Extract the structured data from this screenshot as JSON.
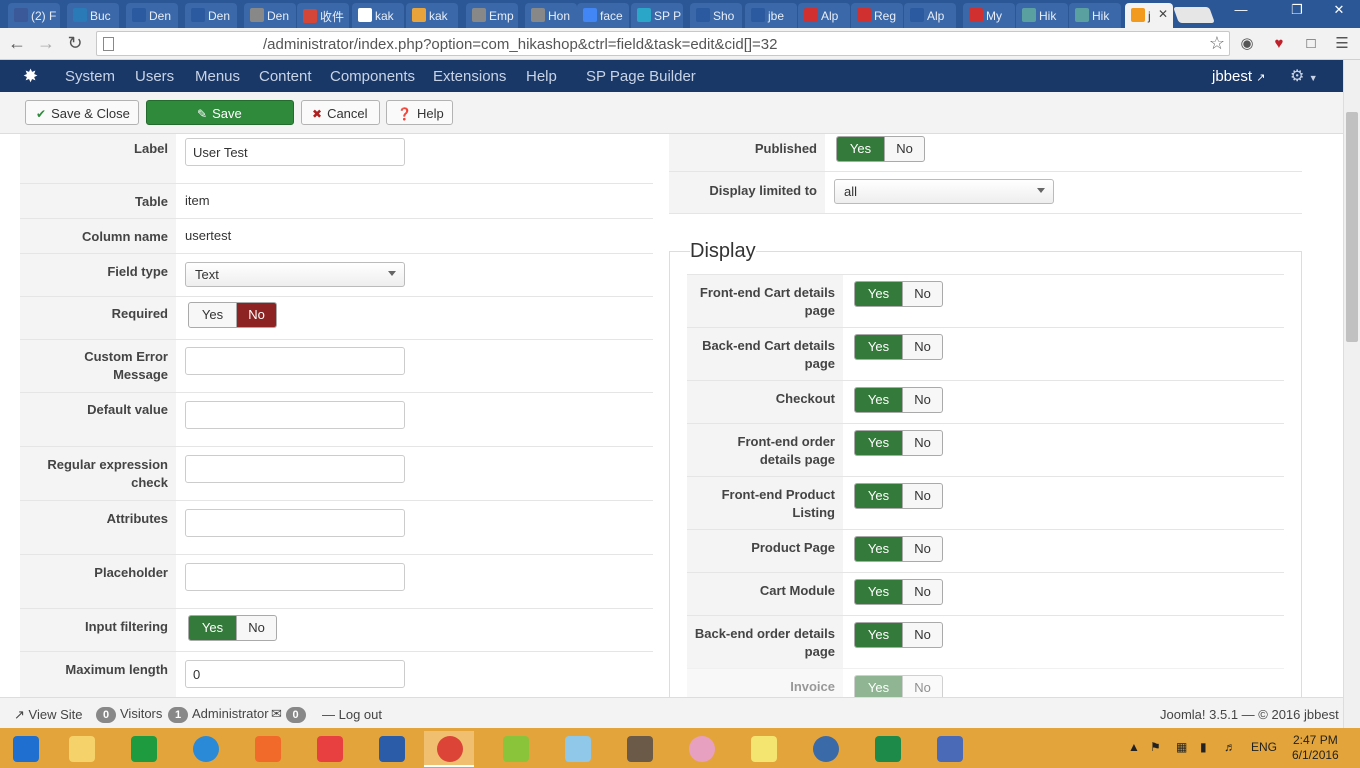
{
  "browser": {
    "tabs": [
      {
        "label": "(2) F",
        "color": "#3b5998"
      },
      {
        "label": "Buc",
        "color": "#2a7ab8"
      },
      {
        "label": "Den",
        "color": "#2c5aa0"
      },
      {
        "label": "Den",
        "color": "#2c5aa0"
      },
      {
        "label": "Den",
        "color": "#888888"
      },
      {
        "label": "收件",
        "color": "#d44638"
      },
      {
        "label": "kak",
        "color": "#ffffff"
      },
      {
        "label": "kak",
        "color": "#e8a33a"
      },
      {
        "label": "Emp",
        "color": "#888888"
      },
      {
        "label": "Hon",
        "color": "#888888"
      },
      {
        "label": "face",
        "color": "#4285f4"
      },
      {
        "label": "SP P",
        "color": "#2aa6c8"
      },
      {
        "label": "Sho",
        "color": "#2c5aa0"
      },
      {
        "label": "jbe",
        "color": "#2c5aa0"
      },
      {
        "label": "Alp",
        "color": "#d03030"
      },
      {
        "label": "Reg",
        "color": "#d03030"
      },
      {
        "label": "Alp",
        "color": "#2c5aa0"
      },
      {
        "label": "My",
        "color": "#d03030"
      },
      {
        "label": "Hik",
        "color": "#5aa0a0"
      },
      {
        "label": "Hik",
        "color": "#5aa0a0"
      },
      {
        "label": "j",
        "color": "#f29a1e"
      }
    ],
    "url": "/administrator/index.php?option=com_hikashop&ctrl=field&task=edit&cid[]=32"
  },
  "adminmenu": {
    "items": [
      "System",
      "Users",
      "Menus",
      "Content",
      "Components",
      "Extensions",
      "Help",
      "SP Page Builder"
    ],
    "user": "jbbest"
  },
  "toolbar": {
    "save_close": "Save & Close",
    "save": "Save",
    "cancel": "Cancel",
    "help": "Help"
  },
  "form": {
    "label": {
      "label": "Label",
      "value": "User Test"
    },
    "table": {
      "label": "Table",
      "value": "item"
    },
    "column_name": {
      "label": "Column name",
      "value": "usertest"
    },
    "field_type": {
      "label": "Field type",
      "value": "Text"
    },
    "required": {
      "label": "Required",
      "yes": "Yes",
      "no": "No",
      "selected": "no"
    },
    "custom_error": {
      "label_line1": "Custom Error",
      "label_line2": "Message",
      "value": ""
    },
    "default_value": {
      "label": "Default value",
      "value": ""
    },
    "regex": {
      "label_line1": "Regular expression",
      "label_line2": "check",
      "value": ""
    },
    "attributes": {
      "label": "Attributes",
      "value": ""
    },
    "placeholder": {
      "label": "Placeholder",
      "value": ""
    },
    "input_filtering": {
      "label": "Input filtering",
      "yes": "Yes",
      "no": "No",
      "selected": "yes"
    },
    "max_length": {
      "label": "Maximum length",
      "value": "0"
    }
  },
  "right": {
    "published": {
      "label": "Published",
      "yes": "Yes",
      "no": "No",
      "selected": "yes"
    },
    "display_limited": {
      "label": "Display limited to",
      "value": "all"
    },
    "display_legend": "Display",
    "display_rows": [
      {
        "line1": "Front-end Cart details",
        "line2": "page"
      },
      {
        "line1": "Back-end Cart details",
        "line2": "page"
      },
      {
        "line1": "Checkout",
        "line2": ""
      },
      {
        "line1": "Front-end order",
        "line2": "details page"
      },
      {
        "line1": "Front-end Product",
        "line2": "Listing"
      },
      {
        "line1": "Product Page",
        "line2": ""
      },
      {
        "line1": "Cart Module",
        "line2": ""
      },
      {
        "line1": "Back-end order details",
        "line2": "page"
      },
      {
        "line1": "Invoice",
        "line2": ""
      }
    ],
    "yes": "Yes",
    "no": "No"
  },
  "statusbar": {
    "view_site": "View Site",
    "visitors_count": "0",
    "visitors": "Visitors",
    "admin_count": "1",
    "admin": "Administrator",
    "messages_count": "0",
    "logout": "Log out",
    "version": "Joomla! 3.5.1  —  © 2016 jbbest"
  },
  "taskbar": {
    "lang": "ENG",
    "time": "2:47 PM",
    "date": "6/1/2016"
  }
}
